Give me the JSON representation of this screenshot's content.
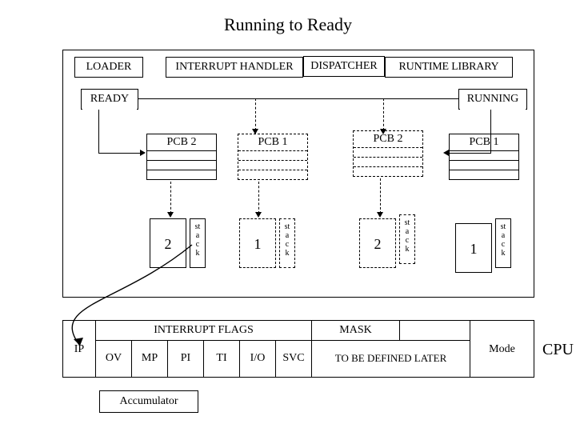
{
  "title": "Running to Ready",
  "modules": {
    "loader": "LOADER",
    "interrupt_handler": "INTERRUPT HANDLER",
    "dispatcher": "DISPATCHER",
    "runtime_library": "RUNTIME LIBRARY"
  },
  "queues": {
    "ready": "READY",
    "running": "RUNNING"
  },
  "pcb": {
    "p1": "PCB 1",
    "p2": "PCB 2"
  },
  "stack_label": "st\na\nc\nk",
  "ids": {
    "one": "1",
    "two": "2"
  },
  "cpu": {
    "ip": "IP",
    "interrupt_flags": "INTERRUPT FLAGS",
    "mask": "MASK",
    "flags": [
      "OV",
      "MP",
      "PI",
      "TI",
      "I/O",
      "SVC"
    ],
    "tbdl": "TO BE DEFINED LATER",
    "mode": "Mode",
    "label": "CPU",
    "accumulator": "Accumulator"
  }
}
